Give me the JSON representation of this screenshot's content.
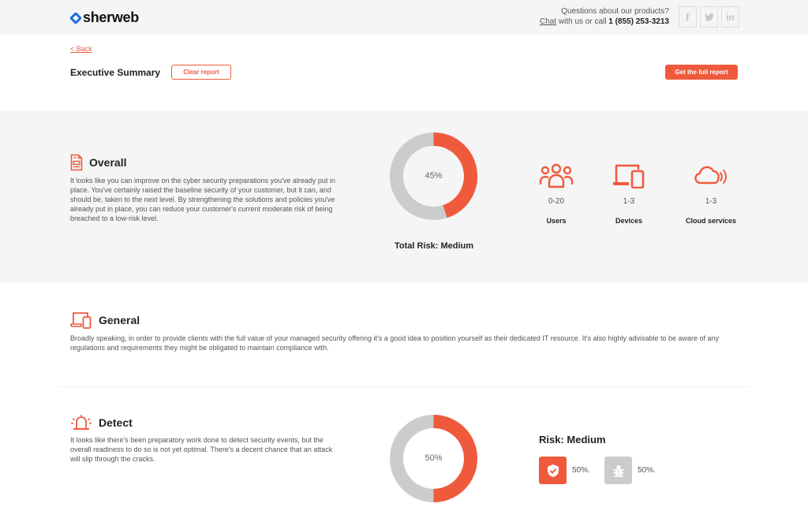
{
  "header": {
    "brand": "sherweb",
    "contact_question": "Questions about our products?",
    "chat_link": "Chat",
    "contact_mid": " with us or call ",
    "phone": "1 (855) 253-3213",
    "social": [
      {
        "icon": "facebook-icon",
        "glyph": "f"
      },
      {
        "icon": "twitter-icon",
        "glyph": "t"
      },
      {
        "icon": "linkedin-icon",
        "glyph": "in"
      }
    ]
  },
  "subheader": {
    "back_label": "< Back",
    "title": "Executive Summary",
    "clear_label": "Clear report",
    "full_report_label": "Get the full report"
  },
  "colors": {
    "accent": "#f05a3c",
    "muted": "#cccccc",
    "band": "#f5f5f5"
  },
  "overall": {
    "title": "Overall",
    "icon": "document-icon",
    "body": "It looks like you can improve on the cyber security preparations you've already put in place. You've certainly raised the baseline security of your customer, but it can, and should be, taken to the next level. By strengthening the solutions and policies you've already put in place, you can reduce your customer's current moderate risk of being breached to a low-risk level.",
    "risk_percent": 45,
    "risk_label": "45%",
    "total_risk": "Total Risk: Medium",
    "stats": [
      {
        "icon": "users-icon",
        "value": "0-20",
        "label": "Users"
      },
      {
        "icon": "devices-icon",
        "value": "1-3",
        "label": "Devices"
      },
      {
        "icon": "cloud-services-icon",
        "value": "1-3",
        "label": "Cloud services"
      }
    ]
  },
  "general": {
    "title": "General",
    "icon": "devices-icon",
    "body": "Broadly speaking, in order to provide clients with the full value of your managed security offering it's a good idea to position yourself as their dedicated IT resource. It's also highly advisable to be aware of any regulations and requirements they might be obligated to maintain compliance with."
  },
  "detect": {
    "title": "Detect",
    "icon": "alarm-light-icon",
    "body": "It looks like there's been preparatory work done to detect security events, but the overall readiness to do so is not yet optimal. There's a decent chance that an attack will slip through the cracks.",
    "risk_percent": 50,
    "risk_label": "50%",
    "risk_title": "Risk: Medium",
    "badges": [
      {
        "icon": "shield-check-icon",
        "value": "50%.",
        "active": true
      },
      {
        "icon": "bug-icon",
        "value": "50%.",
        "active": false
      }
    ]
  }
}
